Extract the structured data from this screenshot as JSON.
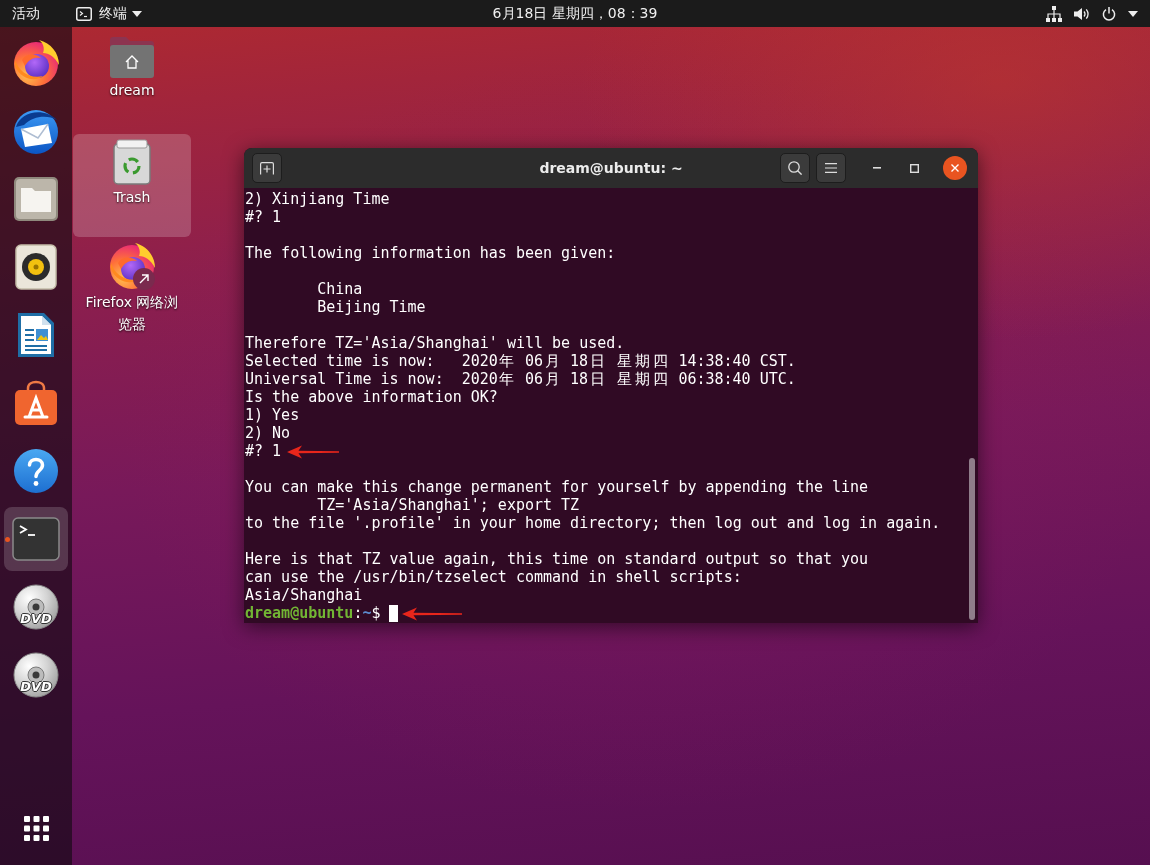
{
  "top_bar": {
    "activities": "活动",
    "app_menu": "终端",
    "clock": "6月18日 星期四，08：39"
  },
  "dock": {
    "items": [
      {
        "kind": "browser",
        "running": false,
        "focused": false
      },
      {
        "kind": "mail",
        "running": false,
        "focused": false
      },
      {
        "kind": "files",
        "running": false,
        "focused": false
      },
      {
        "kind": "music",
        "running": false,
        "focused": false
      },
      {
        "kind": "writer",
        "running": false,
        "focused": false
      },
      {
        "kind": "store",
        "running": false,
        "focused": false
      },
      {
        "kind": "help",
        "running": false,
        "focused": false
      },
      {
        "kind": "terminal",
        "running": true,
        "focused": true
      },
      {
        "kind": "disc",
        "label": "DVD",
        "running": false,
        "focused": false
      },
      {
        "kind": "disc",
        "label": "DVD",
        "running": false,
        "focused": false
      }
    ]
  },
  "desktop": {
    "items": [
      {
        "kind": "home",
        "label": "dream",
        "selected": false,
        "shortcut": false
      },
      {
        "kind": "trash",
        "label": "Trash",
        "selected": true,
        "shortcut": false
      },
      {
        "kind": "browser",
        "label": "Firefox 网络浏览器",
        "selected": false,
        "shortcut": true
      }
    ]
  },
  "terminal": {
    "title": "dream@ubuntu: ~",
    "blocks": [
      {
        "lines": [
          {
            "text": "2) Xinjiang Time",
            "indented": false,
            "marked": false
          },
          {
            "text": "#? 1",
            "indented": false,
            "marked": false
          }
        ]
      },
      {
        "lines": [
          {
            "text": "The following information has been given:",
            "indented": false,
            "marked": false
          }
        ]
      },
      {
        "lines": [
          {
            "text": "China",
            "indented": true,
            "marked": false
          },
          {
            "text": "Beijing Time",
            "indented": true,
            "marked": false
          }
        ]
      },
      {
        "lines": [
          {
            "text": "Therefore TZ='Asia/Shanghai' will be used.",
            "indented": false,
            "marked": false
          },
          {
            "text": "Selected time is now:   2020年 06月 18日 星期四 14:38:40 CST.",
            "indented": false,
            "marked": false
          },
          {
            "text": "Universal Time is now:  2020年 06月 18日 星期四 06:38:40 UTC.",
            "indented": false,
            "marked": false
          },
          {
            "text": "Is the above information OK?",
            "indented": false,
            "marked": false
          },
          {
            "text": "1) Yes",
            "indented": false,
            "marked": false
          },
          {
            "text": "2) No",
            "indented": false,
            "marked": false
          },
          {
            "text": "#? 1",
            "indented": false,
            "marked": true
          }
        ]
      },
      {
        "lines": [
          {
            "text": "You can make this change permanent for yourself by appending the line",
            "indented": false,
            "marked": false
          },
          {
            "text": "TZ='Asia/Shanghai'; export TZ",
            "indented": true,
            "marked": false
          },
          {
            "text": "to the file '.profile' in your home directory; then log out and log in again.",
            "indented": false,
            "marked": false
          }
        ]
      },
      {
        "lines": [
          {
            "text": "Here is that TZ value again, this time on standard output so that you",
            "indented": false,
            "marked": false
          },
          {
            "text": "can use the /usr/bin/tzselect command in shell scripts:",
            "indented": false,
            "marked": false
          },
          {
            "text": "Asia/Shanghai",
            "indented": false,
            "marked": false
          }
        ]
      }
    ],
    "prompt": {
      "user_host": "dream@ubuntu",
      "separator": ":",
      "path": "~",
      "symbol": "$",
      "marked": true
    }
  }
}
